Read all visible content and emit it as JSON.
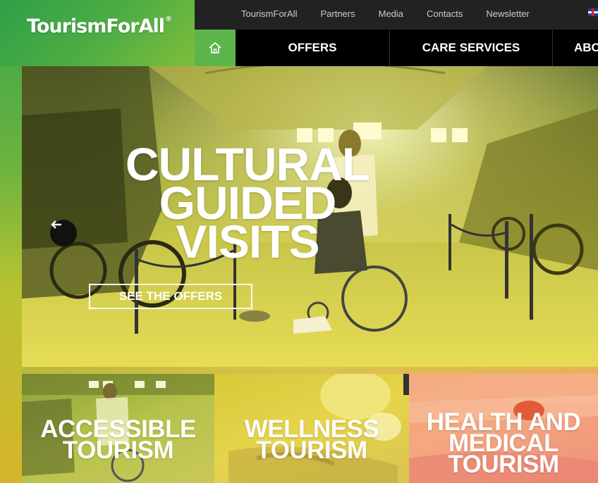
{
  "brand": {
    "name": "TourismForAll",
    "mark": "®"
  },
  "topbar": {
    "links": [
      "TourismForAll",
      "Partners",
      "Media",
      "Contacts",
      "Newsletter"
    ],
    "language_icon": "uk-flag-icon"
  },
  "mainnav": {
    "home_icon": "home-icon",
    "items": [
      "OFFERS",
      "CARE SERVICES",
      "ABO"
    ]
  },
  "hero": {
    "title_lines": [
      "CULTURAL",
      "GUIDED",
      "VISITS"
    ],
    "cta_label": "SEE THE OFFERS",
    "prev_icon": "arrow-left-icon"
  },
  "tiles": [
    {
      "lines": [
        "ACCESSIBLE",
        "TOURISM"
      ]
    },
    {
      "lines": [
        "WELLNESS",
        "TOURISM"
      ]
    },
    {
      "lines": [
        "HEALTH AND",
        "MEDICAL",
        "TOURISM"
      ]
    }
  ],
  "colors": {
    "brand_green": "#4fae44",
    "nav_black": "#000000",
    "topbar_dark": "#222222",
    "hero_yellow": "#e3d84a"
  }
}
